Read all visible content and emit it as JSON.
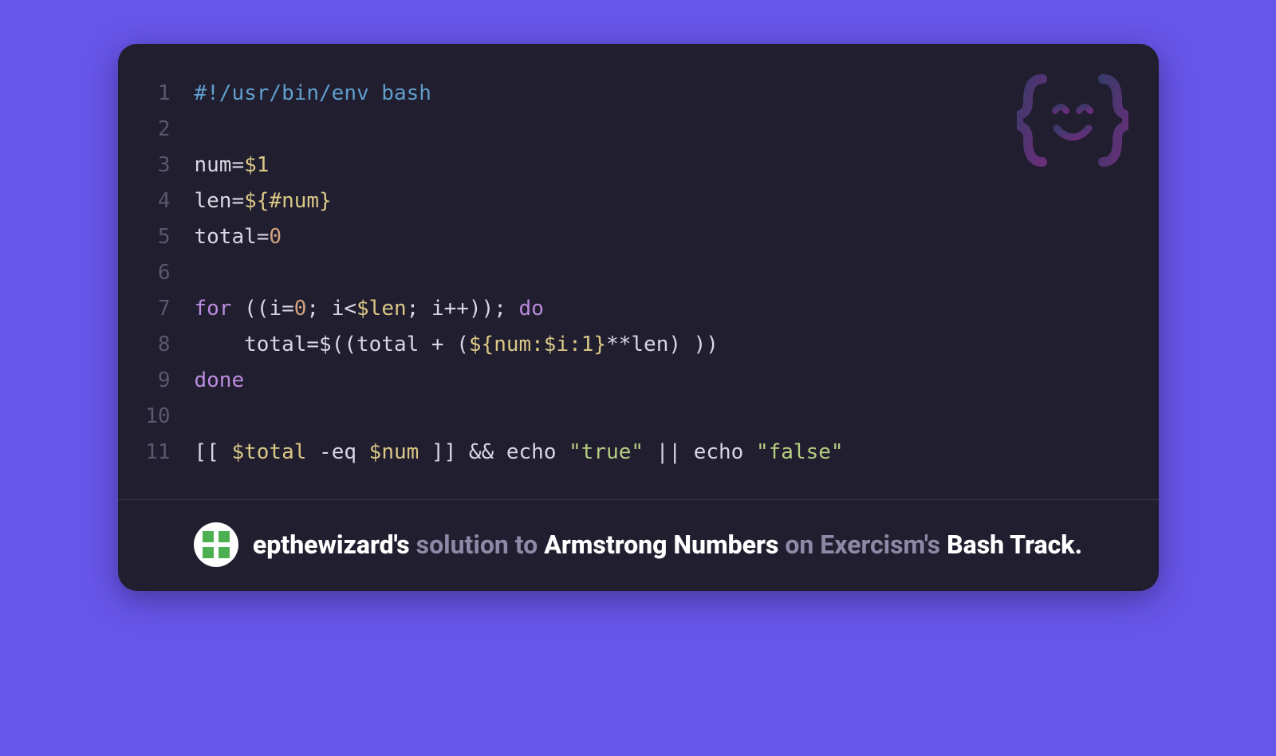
{
  "caption": {
    "username": "epthewizard's",
    "solution_to": "solution to",
    "exercise": "Armstrong Numbers",
    "on_exercism": "on Exercism's",
    "track": "Bash Track."
  },
  "code": {
    "lines": [
      {
        "n": "1",
        "tokens": [
          {
            "cls": "tk-shebang",
            "text": "#!/usr/bin/env bash"
          }
        ]
      },
      {
        "n": "2",
        "tokens": [
          {
            "cls": "tk-default",
            "text": ""
          }
        ]
      },
      {
        "n": "3",
        "tokens": [
          {
            "cls": "tk-var",
            "text": "num="
          },
          {
            "cls": "tk-param",
            "text": "$1"
          }
        ]
      },
      {
        "n": "4",
        "tokens": [
          {
            "cls": "tk-var",
            "text": "len="
          },
          {
            "cls": "tk-param",
            "text": "${#num}"
          }
        ]
      },
      {
        "n": "5",
        "tokens": [
          {
            "cls": "tk-var",
            "text": "total="
          },
          {
            "cls": "tk-num",
            "text": "0"
          }
        ]
      },
      {
        "n": "6",
        "tokens": [
          {
            "cls": "tk-default",
            "text": ""
          }
        ]
      },
      {
        "n": "7",
        "tokens": [
          {
            "cls": "tk-keyword",
            "text": "for"
          },
          {
            "cls": "tk-default",
            "text": " (("
          },
          {
            "cls": "tk-var",
            "text": "i="
          },
          {
            "cls": "tk-num",
            "text": "0"
          },
          {
            "cls": "tk-default",
            "text": "; i<"
          },
          {
            "cls": "tk-param",
            "text": "$len"
          },
          {
            "cls": "tk-default",
            "text": "; i++)); "
          },
          {
            "cls": "tk-keyword",
            "text": "do"
          }
        ]
      },
      {
        "n": "8",
        "tokens": [
          {
            "cls": "tk-default",
            "text": "    "
          },
          {
            "cls": "tk-var",
            "text": "total="
          },
          {
            "cls": "tk-default",
            "text": "$((total + ("
          },
          {
            "cls": "tk-param",
            "text": "${num:$i:1}"
          },
          {
            "cls": "tk-default",
            "text": "**len) ))"
          }
        ]
      },
      {
        "n": "9",
        "tokens": [
          {
            "cls": "tk-keyword",
            "text": "done"
          }
        ]
      },
      {
        "n": "10",
        "tokens": [
          {
            "cls": "tk-default",
            "text": ""
          }
        ]
      },
      {
        "n": "11",
        "tokens": [
          {
            "cls": "tk-default",
            "text": "[[ "
          },
          {
            "cls": "tk-param",
            "text": "$total"
          },
          {
            "cls": "tk-default",
            "text": " -eq "
          },
          {
            "cls": "tk-param",
            "text": "$num"
          },
          {
            "cls": "tk-default",
            "text": " ]] && "
          },
          {
            "cls": "tk-builtin",
            "text": "echo"
          },
          {
            "cls": "tk-default",
            "text": " "
          },
          {
            "cls": "tk-string",
            "text": "\"true\""
          },
          {
            "cls": "tk-default",
            "text": " || "
          },
          {
            "cls": "tk-builtin",
            "text": "echo"
          },
          {
            "cls": "tk-default",
            "text": " "
          },
          {
            "cls": "tk-string",
            "text": "\"false\""
          }
        ]
      }
    ]
  }
}
